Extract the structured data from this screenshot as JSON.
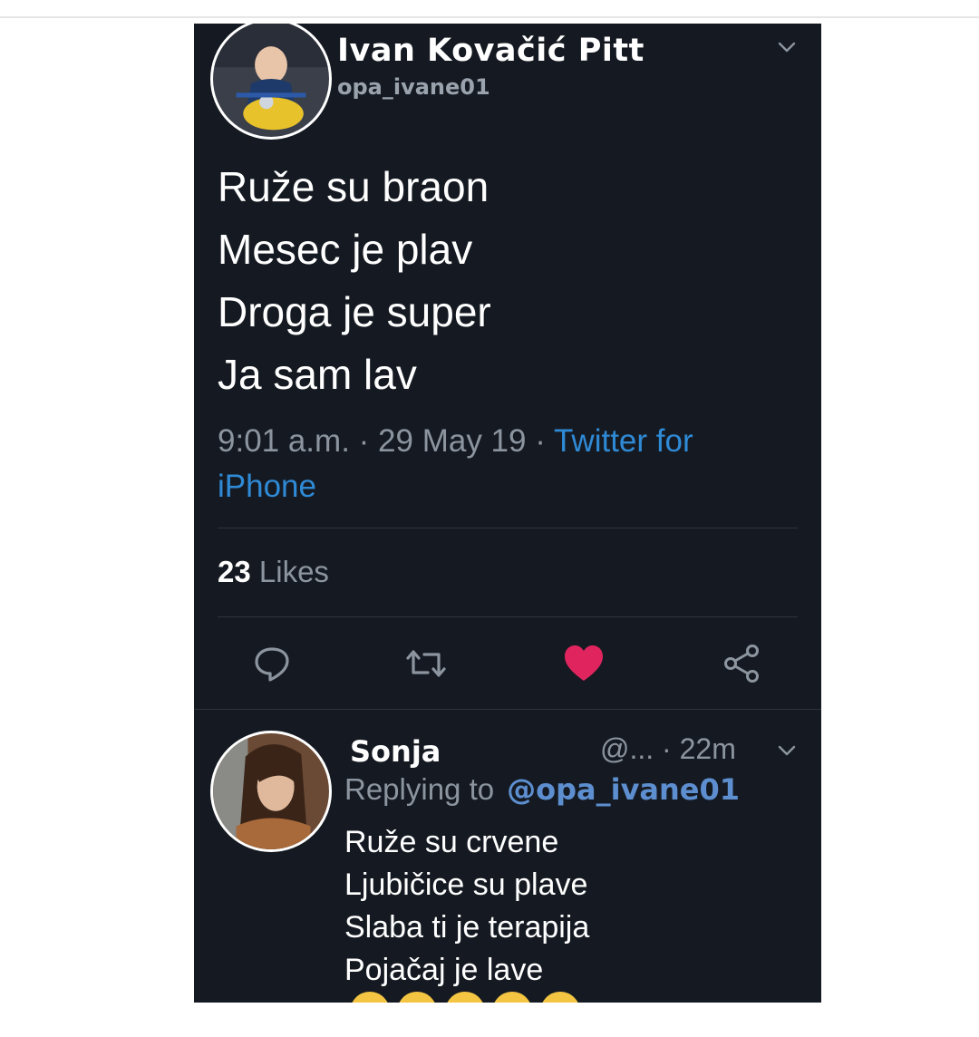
{
  "tweet": {
    "author": {
      "display_name": "Ivan Kovačić Pitt",
      "handle": "opa_ivane01"
    },
    "text_lines": [
      "Ruže su braon",
      "Mesec je plav",
      "Droga je super",
      "Ja sam lav"
    ],
    "time": "9:01 a.m.",
    "separator": "·",
    "date": "29 May 19",
    "source": "Twitter for iPhone",
    "likes_count": "23",
    "likes_label": "Likes",
    "liked": true,
    "actions": [
      "reply-icon",
      "retweet-icon",
      "heart-icon",
      "share-icon"
    ]
  },
  "reply": {
    "display_name": "Sonja",
    "handle_truncated": "@...",
    "separator": "·",
    "age": "22m",
    "replying_label": "Replying to",
    "replying_to": "@opa_ivane01",
    "text_lines": [
      "Ruže su crvene",
      "Ljubičice su plave",
      "Slaba ti je terapija",
      "Pojačaj je lave"
    ]
  },
  "colors": {
    "background": "#151a22",
    "link": "#2f8ad6",
    "mention": "#5d8fd0",
    "like": "#e0245e",
    "muted": "#8c959f"
  }
}
